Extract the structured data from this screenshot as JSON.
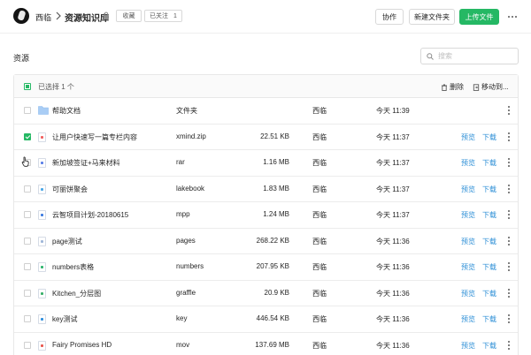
{
  "header": {
    "user": "西临",
    "repo_title": "资源知识库",
    "favorite_label": "收藏",
    "follow_label": "已关注",
    "follow_count": "1",
    "collab_label": "协作",
    "new_folder_label": "新建文件夹",
    "upload_label": "上传文件"
  },
  "section": {
    "title": "资源",
    "search_placeholder": "搜索"
  },
  "toolbar": {
    "selected_text": "已选择 1 个",
    "delete_label": "删除",
    "move_label": "移动到..."
  },
  "colors": {
    "accent": "#25b864",
    "link": "#2b8ed6"
  },
  "files": [
    {
      "name": "帮助文档",
      "type": "文件夹",
      "size": "",
      "owner": "西临",
      "time": "今天 11:39",
      "checked": false,
      "icon": "folder-icon",
      "actions": false
    },
    {
      "name": "让用户快速写一篇专栏内容",
      "type": "xmind.zip",
      "size": "22.51 KB",
      "owner": "西临",
      "time": "今天 11:37",
      "checked": true,
      "icon": "zip-file-icon",
      "icon_color": "#f06060",
      "actions": true
    },
    {
      "name": "新加坡签证+马来材料",
      "type": "rar",
      "size": "1.16 MB",
      "owner": "西临",
      "time": "今天 11:37",
      "checked": false,
      "icon": "rar-file-icon",
      "icon_color": "#5b7fe8",
      "actions": true
    },
    {
      "name": "可丽饼聚会",
      "type": "lakebook",
      "size": "1.83 MB",
      "owner": "西临",
      "time": "今天 11:37",
      "checked": false,
      "icon": "lakebook-file-icon",
      "icon_color": "#4aa7e8",
      "actions": true
    },
    {
      "name": "云智项目计划-20180615",
      "type": "mpp",
      "size": "1.24 MB",
      "owner": "西临",
      "time": "今天 11:37",
      "checked": false,
      "icon": "mpp-file-icon",
      "icon_color": "#3d7be0",
      "actions": true
    },
    {
      "name": "page测试",
      "type": "pages",
      "size": "268.22 KB",
      "owner": "西临",
      "time": "今天 11:36",
      "checked": false,
      "icon": "pages-file-icon",
      "icon_color": "#9fb6d8",
      "actions": true
    },
    {
      "name": "numbers表格",
      "type": "numbers",
      "size": "207.95 KB",
      "owner": "西临",
      "time": "今天 11:36",
      "checked": false,
      "icon": "numbers-file-icon",
      "icon_color": "#2fb56f",
      "actions": true
    },
    {
      "name": "Kitchen_分层图",
      "type": "graffle",
      "size": "20.9 KB",
      "owner": "西临",
      "time": "今天 11:36",
      "checked": false,
      "icon": "graffle-file-icon",
      "icon_color": "#3ab06a",
      "actions": true
    },
    {
      "name": "key测试",
      "type": "key",
      "size": "446.54 KB",
      "owner": "西临",
      "time": "今天 11:36",
      "checked": false,
      "icon": "key-file-icon",
      "icon_color": "#2f8fde",
      "actions": true
    },
    {
      "name": "Fairy Promises HD",
      "type": "mov",
      "size": "137.69 MB",
      "owner": "西临",
      "time": "今天 11:36",
      "checked": false,
      "icon": "mov-file-icon",
      "icon_color": "#e8574f",
      "actions": true
    }
  ],
  "row_actions": {
    "preview_label": "预览",
    "download_label": "下载"
  }
}
